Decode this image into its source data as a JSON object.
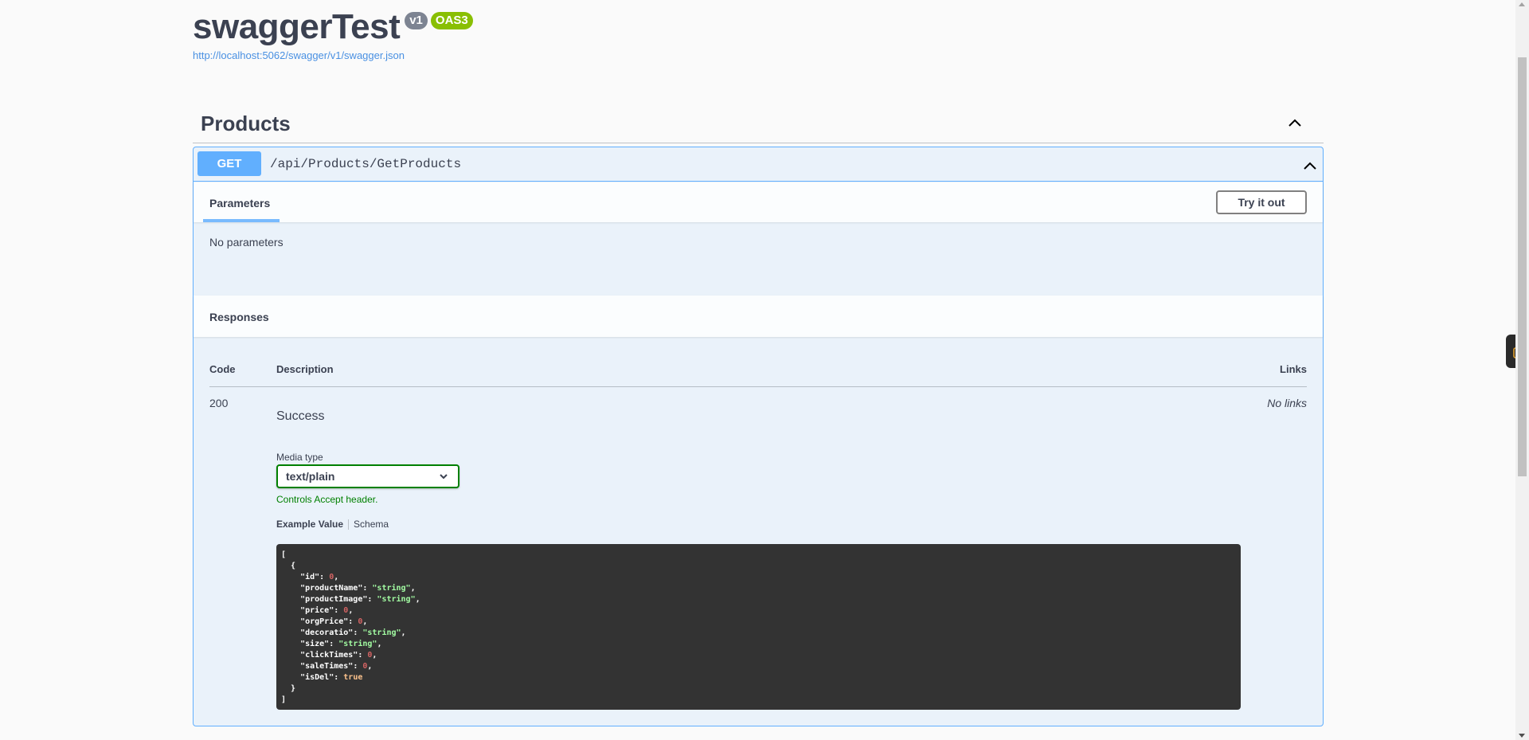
{
  "header": {
    "title": "swaggerTest",
    "version_badge": "v1",
    "oas_badge": "OAS3",
    "spec_url": "http://localhost:5062/swagger/v1/swagger.json"
  },
  "tag": {
    "name": "Products",
    "chevron_icon": "chevron-up-icon"
  },
  "operation": {
    "method": "GET",
    "path": "/api/Products/GetProducts",
    "method_color": "#61affe",
    "tabs": {
      "parameters": "Parameters"
    },
    "try_it_out": "Try it out",
    "no_parameters": "No parameters",
    "responses_title": "Responses",
    "columns": {
      "code": "Code",
      "description": "Description",
      "links": "Links"
    },
    "responses": [
      {
        "code": "200",
        "description": "Success",
        "links": "No links",
        "media_type_label": "Media type",
        "media_type": "text/plain",
        "controls_note": "Controls Accept header.",
        "example_tabs": {
          "value": "Example Value",
          "schema": "Schema"
        },
        "example_fields": [
          {
            "key": "id",
            "value": "0",
            "type": "number"
          },
          {
            "key": "productName",
            "value": "\"string\"",
            "type": "string"
          },
          {
            "key": "productImage",
            "value": "\"string\"",
            "type": "string"
          },
          {
            "key": "price",
            "value": "0",
            "type": "number"
          },
          {
            "key": "orgPrice",
            "value": "0",
            "type": "number"
          },
          {
            "key": "decoratio",
            "value": "\"string\"",
            "type": "string"
          },
          {
            "key": "size",
            "value": "\"string\"",
            "type": "string"
          },
          {
            "key": "clickTimes",
            "value": "0",
            "type": "number"
          },
          {
            "key": "saleTimes",
            "value": "0",
            "type": "number"
          },
          {
            "key": "isDel",
            "value": "true",
            "type": "boolean"
          }
        ]
      }
    ]
  },
  "colors": {
    "get": "#61affe",
    "version_badge": "#7d8492",
    "oas_badge": "#89bf04",
    "accept_note": "#008000"
  }
}
